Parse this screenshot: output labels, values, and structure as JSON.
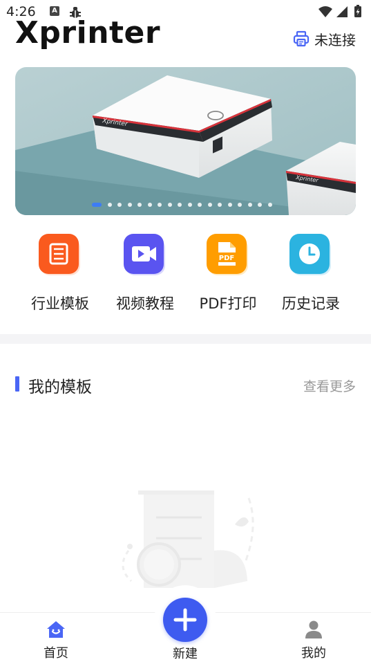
{
  "status_bar": {
    "time": "4:26",
    "notification_icons": [
      "keyboard-a-icon",
      "bug-icon"
    ],
    "system_icons": [
      "wifi-icon",
      "signal-icon",
      "battery-charging-icon"
    ]
  },
  "header": {
    "app_title": "Xprinter",
    "connect_status": "未连接",
    "connect_icon": "printer-icon"
  },
  "banner": {
    "image": "label-printer-photo",
    "brand_on_device": "Xprinter",
    "page_count": 18,
    "active_index": 0
  },
  "quick_actions": [
    {
      "label": "行业模板",
      "icon": "template-list-icon",
      "color": "#fa5a1e"
    },
    {
      "label": "视频教程",
      "icon": "video-icon",
      "color": "#5a54f0"
    },
    {
      "label": "PDF打印",
      "icon": "pdf-icon",
      "icon_text": "PDF",
      "color": "#ff9d00"
    },
    {
      "label": "历史记录",
      "icon": "clock-icon",
      "color": "#2bb3e0"
    }
  ],
  "my_templates": {
    "title": "我的模板",
    "more_label": "查看更多",
    "accent": "#4a66f5"
  },
  "tab_bar": {
    "tabs": [
      {
        "label": "首页",
        "icon": "home-icon",
        "active": true
      },
      {
        "label": "新建",
        "icon": "plus-icon"
      },
      {
        "label": "我的",
        "icon": "user-icon"
      }
    ],
    "accent": "#3e5bf0"
  }
}
